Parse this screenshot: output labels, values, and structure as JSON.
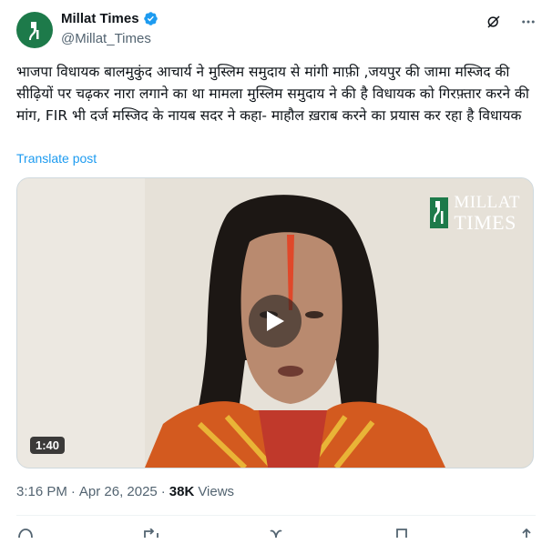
{
  "author": {
    "display_name": "Millat Times",
    "handle": "@Millat_Times",
    "verified": true,
    "brand_color": "#1d7a4a"
  },
  "post": {
    "text": "भाजपा विधायक बालमुकुंद आचार्य ने मुस्लिम समुदाय से मांगी माफ़ी ,जयपुर की जामा मस्जिद की सीढ़ियों पर चढ़कर नारा लगाने का था मामला मुस्लिम समुदाय ने की है विधायक को गिरफ़्तार करने की मांग, FIR भी दर्ज मस्जिद के नायब सदर ने कहा- माहौल ख़राब करने का प्रयास कर रहा है विधायक",
    "translate_label": "Translate post",
    "link_color": "#1d9bf0"
  },
  "media": {
    "watermark_line1": "MILLAT",
    "watermark_line2": "TIMES",
    "duration": "1:40",
    "play_icon": "play-icon"
  },
  "meta": {
    "time": "3:16 PM",
    "separator": "·",
    "date": "Apr 26, 2025",
    "views_count": "38K",
    "views_label": "Views"
  },
  "icons": {
    "grok": "grok-icon",
    "more": "more-icon",
    "reply": "reply-icon",
    "repost": "repost-icon",
    "like": "like-icon",
    "bookmark": "bookmark-icon",
    "share": "share-icon"
  }
}
